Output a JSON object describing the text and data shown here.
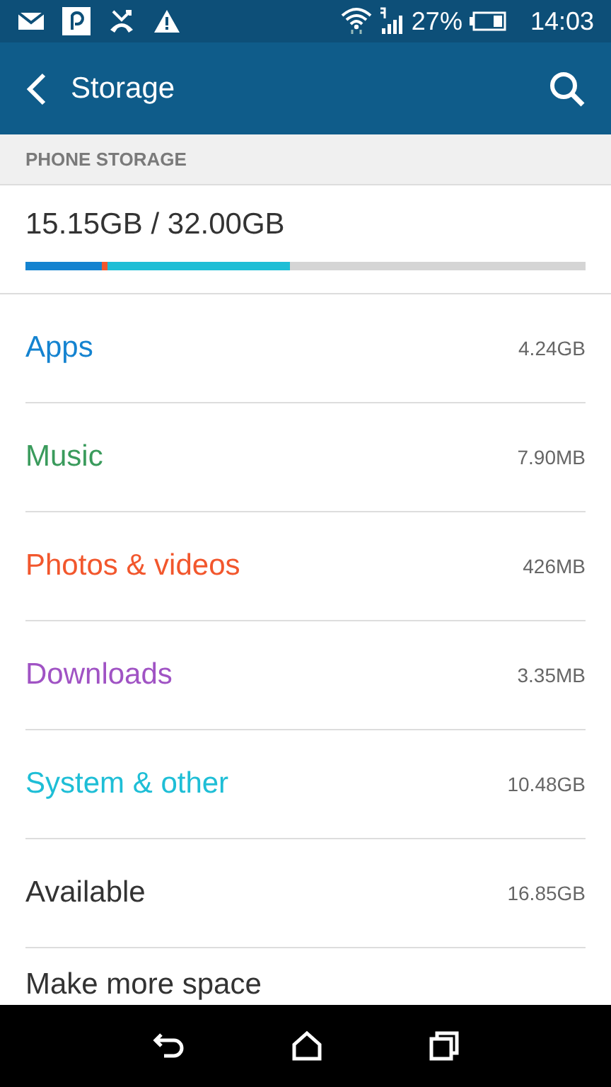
{
  "status_bar": {
    "battery": "27%",
    "time": "14:03"
  },
  "app_bar": {
    "title": "Storage"
  },
  "section": {
    "title": "PHONE STORAGE"
  },
  "summary": {
    "used": "15.15GB / 32.00GB"
  },
  "categories": [
    {
      "label": "Apps",
      "size": "4.24GB",
      "color": "#1483d0",
      "level": 0.136
    },
    {
      "label": "Music",
      "size": "7.90MB",
      "color": "#3a9b5c"
    },
    {
      "label": "Photos & videos",
      "size": "426MB",
      "color": "#f2572d",
      "level": 0.01
    },
    {
      "label": "Downloads",
      "size": "3.35MB",
      "color": "#a053c4"
    },
    {
      "label": "System & other",
      "size": "10.48GB",
      "color": "#1ebed6",
      "level": 0.326
    },
    {
      "label": "Available",
      "size": "16.85GB",
      "color": "#333333"
    }
  ],
  "actions": [
    {
      "label": "Make more space"
    }
  ]
}
